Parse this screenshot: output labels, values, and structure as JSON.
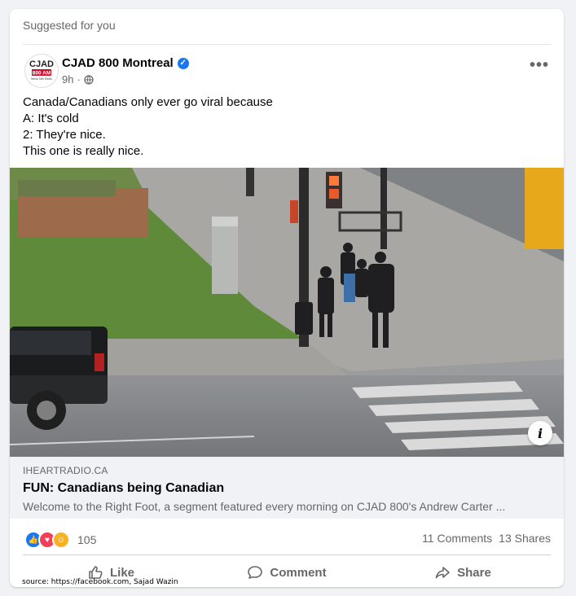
{
  "header": {
    "suggested_label": "Suggested for you"
  },
  "post": {
    "page_name": "CJAD 800 Montreal",
    "avatar_text_top": "CJAD",
    "avatar_text_mid": "800 AM",
    "avatar_text_bottom": "News Talk Radio",
    "time": "9h",
    "privacy_icon": "globe-icon",
    "text_lines": [
      "Canada/Canadians only ever go viral because",
      "A: It's cold",
      "2: They're nice.",
      "This one is really nice."
    ]
  },
  "link": {
    "domain": "IHEARTRADIO.CA",
    "title": "FUN: Canadians being Canadian",
    "description": "Welcome to the Right Foot, a segment featured every morning on CJAD 800's Andrew Carter ..."
  },
  "stats": {
    "reaction_count": "105",
    "comments": "11 Comments",
    "shares": "13 Shares"
  },
  "actions": {
    "like": "Like",
    "comment": "Comment",
    "share": "Share"
  },
  "footer": {
    "source": "source: https://facebook.com, Sajad Wazin"
  },
  "colors": {
    "accent": "#1877f2",
    "secondary_text": "#65676b",
    "link_box_bg": "#f0f2f5"
  }
}
